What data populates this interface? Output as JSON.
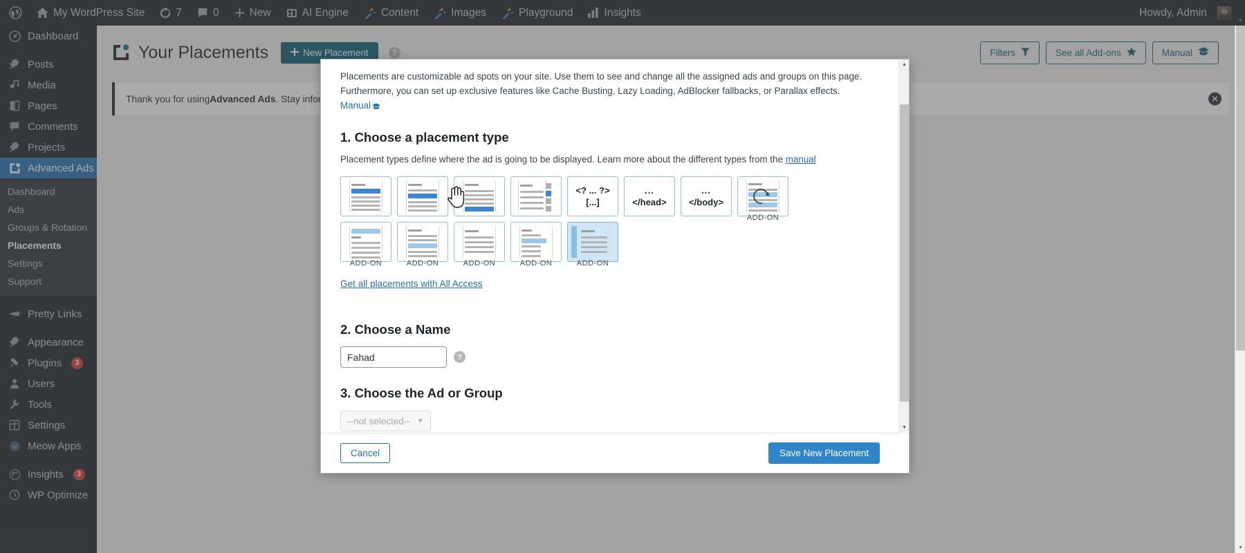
{
  "adminbar": {
    "items": [
      {
        "icon": "wordpress-logo-icon",
        "label": ""
      },
      {
        "icon": "home-icon",
        "label": "My WordPress Site"
      },
      {
        "icon": "updates-icon",
        "label": "7"
      },
      {
        "icon": "comment-bubble-icon",
        "label": "0"
      },
      {
        "icon": "plus-icon",
        "label": "New"
      },
      {
        "icon": "ai-engine-icon",
        "label": "AI Engine"
      },
      {
        "icon": "magic-wand-icon",
        "label": "Content"
      },
      {
        "icon": "magic-wand-icon",
        "label": "Images"
      },
      {
        "icon": "magic-wand-icon",
        "label": "Playground"
      },
      {
        "icon": "bar-chart-icon",
        "label": "Insights"
      }
    ],
    "howdy": "Howdy, Admin"
  },
  "sidebar": {
    "items": [
      {
        "label": "Dashboard",
        "icon": "dashboard-icon",
        "gap_before": false
      },
      {
        "label": "Posts",
        "icon": "pin-icon",
        "gap_before": true
      },
      {
        "label": "Media",
        "icon": "media-icon",
        "gap_before": false
      },
      {
        "label": "Pages",
        "icon": "pages-icon",
        "gap_before": false
      },
      {
        "label": "Comments",
        "icon": "comment-icon",
        "gap_before": false
      },
      {
        "label": "Projects",
        "icon": "pin-icon",
        "gap_before": false
      },
      {
        "label": "Advanced Ads",
        "icon": "advanced-ads-icon",
        "gap_before": false,
        "current": true
      },
      {
        "label": "Pretty Links",
        "icon": "pretty-links-icon",
        "gap_before": true
      },
      {
        "label": "Appearance",
        "icon": "appearance-icon",
        "gap_before": true
      },
      {
        "label": "Plugins",
        "icon": "plugins-icon",
        "gap_before": false,
        "badge": "3"
      },
      {
        "label": "Users",
        "icon": "users-icon",
        "gap_before": false
      },
      {
        "label": "Tools",
        "icon": "tools-icon",
        "gap_before": false
      },
      {
        "label": "Settings",
        "icon": "settings-icon",
        "gap_before": false
      },
      {
        "label": "Meow Apps",
        "icon": "meow-apps-icon",
        "gap_before": false
      },
      {
        "label": "Insights",
        "icon": "insights-icon",
        "gap_before": true,
        "badge": "3"
      },
      {
        "label": "WP Optimize",
        "icon": "wp-optimize-icon",
        "gap_before": false
      }
    ],
    "submenu": [
      {
        "label": "Dashboard",
        "active": false
      },
      {
        "label": "Ads",
        "active": false
      },
      {
        "label": "Groups & Rotation",
        "active": false
      },
      {
        "label": "Placements",
        "active": true
      },
      {
        "label": "Settings",
        "active": false
      },
      {
        "label": "Support",
        "active": false
      }
    ]
  },
  "page": {
    "title": "Your Placements",
    "new_placement_button": "New Placement",
    "help_icon": "?",
    "header_buttons": [
      {
        "label": "Filters",
        "icon": "funnel-icon"
      },
      {
        "label": "See all Add-ons",
        "icon": "star-icon"
      },
      {
        "label": "Manual",
        "icon": "graduation-cap-icon"
      }
    ],
    "notice": {
      "text_1": "Thank you for using ",
      "text_bold": "Advanced Ads",
      "text_2": ". Stay infor",
      "dismiss_icon": "close-icon"
    }
  },
  "modal": {
    "intro_line_1": "Placements are customizable ad spots on your site. Use them to see and change all the assigned ads and groups on this page.",
    "intro_line_2": "Furthermore, you can set up exclusive features like Cache Busting, Lazy Loading, AdBlocker fallbacks, or Parallax effects.",
    "intro_manual_link": "Manual",
    "step1_title": "1. Choose a placement type",
    "step1_desc_prefix": "Placement types define where the ad is going to be displayed. Learn more about the different types from the ",
    "step1_desc_link": "manual",
    "placement_types": [
      {
        "name": "before-content",
        "kind": "wireframe",
        "variant": "bar-top",
        "addon": ""
      },
      {
        "name": "after-paragraph",
        "kind": "wireframe",
        "variant": "bar-mid",
        "addon": ""
      },
      {
        "name": "after-content",
        "kind": "wireframe",
        "variant": "bar-bottom",
        "addon": ""
      },
      {
        "name": "sidebar-widget",
        "kind": "wireframe",
        "variant": "sidebar-blocks",
        "addon": ""
      },
      {
        "name": "php-code",
        "kind": "code",
        "line1": "<? ... ?>",
        "line2": "[...]",
        "addon": ""
      },
      {
        "name": "header-code",
        "kind": "code",
        "line1": "...",
        "line2": "</head>",
        "addon": ""
      },
      {
        "name": "footer-code",
        "kind": "code",
        "line1": "...",
        "line2": "</body>",
        "addon": ""
      },
      {
        "name": "auto-refresh",
        "kind": "wireframe",
        "variant": "refresh",
        "addon": "ADD-ON"
      },
      {
        "name": "header-area",
        "kind": "wireframe",
        "variant": "lite-top",
        "addon": "ADD-ON"
      },
      {
        "name": "content-middle",
        "kind": "wireframe",
        "variant": "lite-mid",
        "addon": "ADD-ON"
      },
      {
        "name": "sticky-layer",
        "kind": "wireframe",
        "variant": "hand",
        "addon": "ADD-ON"
      },
      {
        "name": "inline-float",
        "kind": "wireframe",
        "variant": "lite-inline",
        "addon": "ADD-ON"
      },
      {
        "name": "sticky-sidebar",
        "kind": "wireframe",
        "variant": "leftbar",
        "addon": "ADD-ON",
        "selected": true
      }
    ],
    "all_access_link": "Get all placements with All Access",
    "step2_title": "2. Choose a Name",
    "name_value": "Fahad",
    "name_placeholder": "",
    "name_help_icon": "?",
    "step3_title": "3. Choose the Ad or Group",
    "select_value": "--not selected--",
    "cancel_button": "Cancel",
    "save_button": "Save New Placement"
  }
}
